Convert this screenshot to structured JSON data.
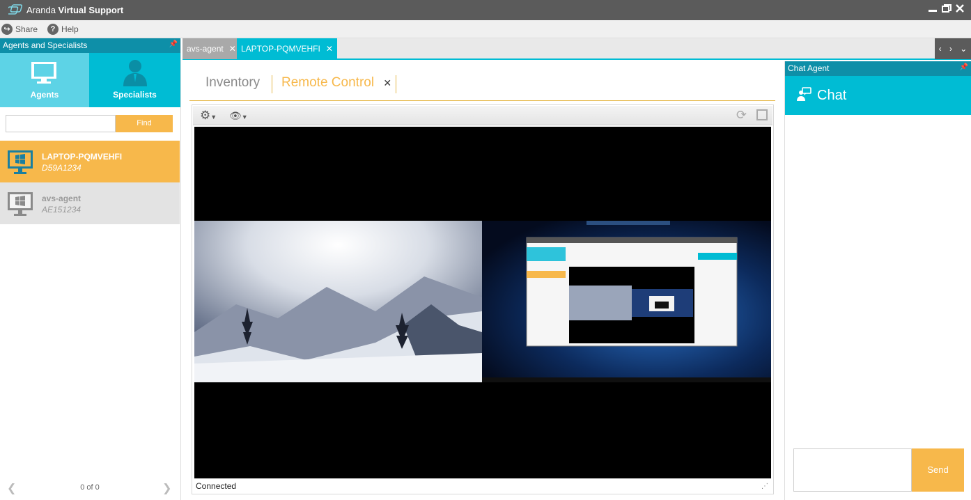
{
  "app": {
    "title_light": "Aranda",
    "title_bold": "Virtual Support"
  },
  "window_controls": {
    "minimize": "minimize-icon",
    "restore": "restore-icon",
    "close": "close-icon"
  },
  "menu": {
    "share": "Share",
    "help": "Help"
  },
  "left_panel": {
    "header": "Agents and Specialists",
    "tabs": [
      {
        "label": "Agents",
        "icon": "monitor-icon"
      },
      {
        "label": "Specialists",
        "icon": "person-icon"
      }
    ],
    "search_value": "",
    "find_label": "Find",
    "agents": [
      {
        "name": "LAPTOP-PQMVEHFI",
        "id": "D59A1234",
        "selected": true
      },
      {
        "name": "avs-agent",
        "id": "AE151234",
        "selected": false
      }
    ],
    "pager": "0 of 0"
  },
  "tabs": [
    {
      "label": "avs-agent",
      "active": false
    },
    {
      "label": "LAPTOP-PQMVEHFI",
      "active": true
    }
  ],
  "subtabs": {
    "inventory": "Inventory",
    "remote_control": "Remote Control"
  },
  "remote": {
    "status": "Connected"
  },
  "chat": {
    "panel_header": "Chat Agent",
    "title": "Chat",
    "input_value": "",
    "send_label": "Send"
  },
  "colors": {
    "teal": "#00bcd4",
    "teal_dark": "#0e8fa8",
    "orange": "#f7b84b",
    "titlebar": "#5b5b5b"
  }
}
